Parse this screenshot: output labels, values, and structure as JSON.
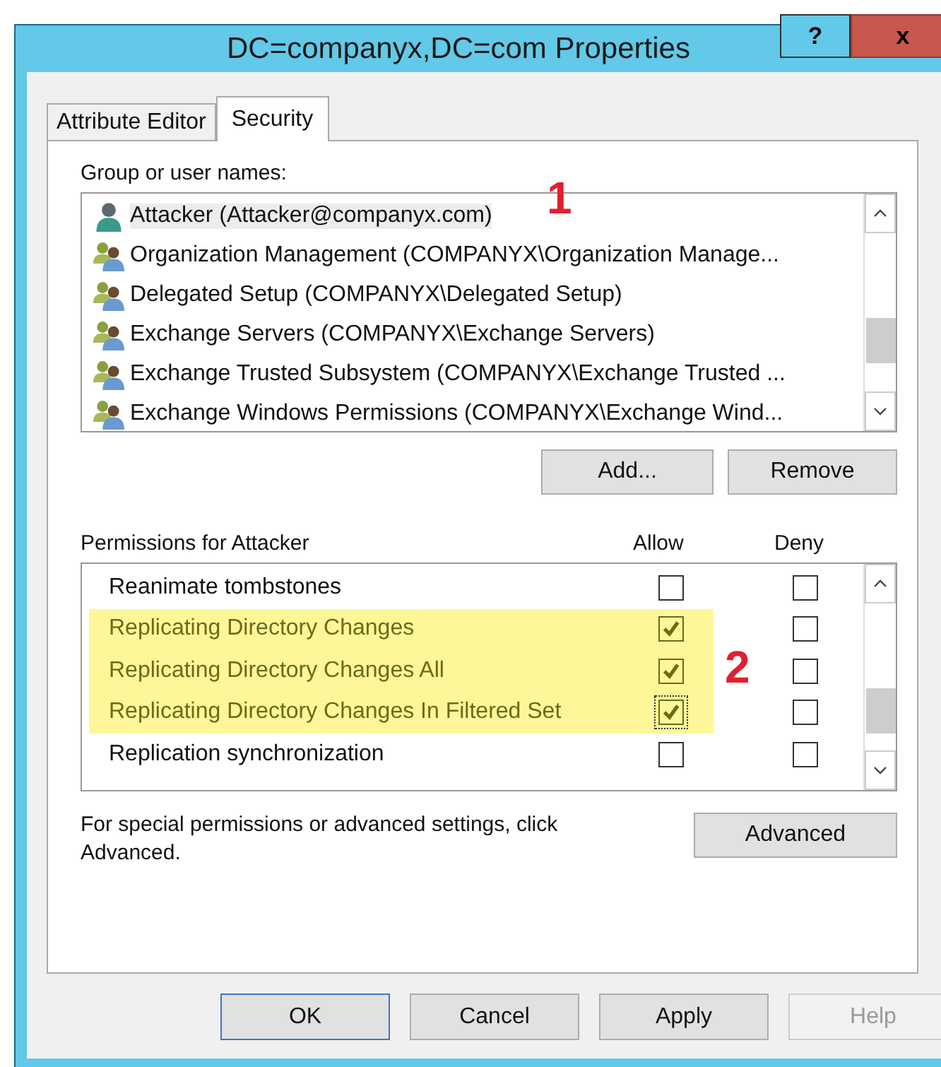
{
  "window": {
    "title": "DC=companyx,DC=com Properties",
    "help_button": "?",
    "close_button": "x"
  },
  "tabs": [
    {
      "label": "Attribute Editor",
      "selected": false
    },
    {
      "label": "Security",
      "selected": true
    }
  ],
  "group_label": "Group or user names:",
  "principals": [
    {
      "name": "Attacker (Attacker@companyx.com)",
      "kind": "user",
      "selected": true
    },
    {
      "name": "Organization Management (COMPANYX\\Organization Manage...",
      "kind": "group",
      "selected": false
    },
    {
      "name": "Delegated Setup (COMPANYX\\Delegated Setup)",
      "kind": "group",
      "selected": false
    },
    {
      "name": "Exchange Servers (COMPANYX\\Exchange Servers)",
      "kind": "group",
      "selected": false
    },
    {
      "name": "Exchange Trusted Subsystem (COMPANYX\\Exchange Trusted ...",
      "kind": "group",
      "selected": false
    },
    {
      "name": "Exchange Windows Permissions (COMPANYX\\Exchange Wind...",
      "kind": "group",
      "selected": false
    }
  ],
  "principal_buttons": [
    "Add...",
    "Remove"
  ],
  "permissions_label": "Permissions for Attacker",
  "allow_header": "Allow",
  "deny_header": "Deny",
  "permissions": [
    {
      "name": "Reanimate tombstones",
      "allow": false,
      "deny": false,
      "highlighted": false,
      "focused": false
    },
    {
      "name": "Replicating Directory Changes",
      "allow": true,
      "deny": false,
      "highlighted": true,
      "focused": false
    },
    {
      "name": "Replicating Directory Changes All",
      "allow": true,
      "deny": false,
      "highlighted": true,
      "focused": false
    },
    {
      "name": "Replicating Directory Changes In Filtered Set",
      "allow": true,
      "deny": false,
      "highlighted": true,
      "focused": true
    },
    {
      "name": "Replication synchronization",
      "allow": false,
      "deny": false,
      "highlighted": false,
      "focused": false
    }
  ],
  "advanced_text": "For special permissions or advanced settings, click Advanced.",
  "advanced_button": "Advanced",
  "annotations": [
    {
      "label": "1"
    },
    {
      "label": "2"
    }
  ],
  "footer_buttons": [
    {
      "label": "OK",
      "disabled": false,
      "default": true
    },
    {
      "label": "Cancel",
      "disabled": false,
      "default": false
    },
    {
      "label": "Apply",
      "disabled": false,
      "default": false
    },
    {
      "label": "Help",
      "disabled": true,
      "default": false
    }
  ]
}
